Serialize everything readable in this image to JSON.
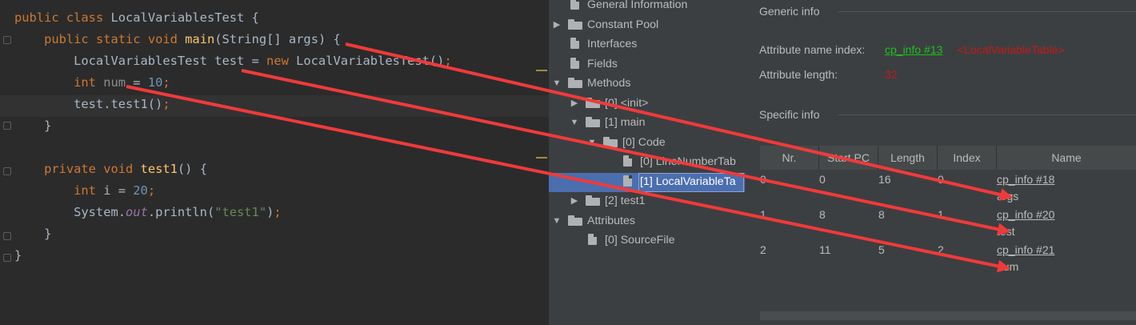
{
  "editor": {
    "lines": [
      [
        {
          "t": "public ",
          "c": "kw"
        },
        {
          "t": "class ",
          "c": "kw"
        },
        {
          "t": "LocalVariablesTest {",
          "c": ""
        }
      ],
      [
        {
          "t": "    public ",
          "c": "kw"
        },
        {
          "t": "static ",
          "c": "kw"
        },
        {
          "t": "void ",
          "c": "kw"
        },
        {
          "t": "main",
          "c": "fn"
        },
        {
          "t": "(String[] args) {",
          "c": ""
        }
      ],
      [
        {
          "t": "        LocalVariablesTest test = ",
          "c": ""
        },
        {
          "t": "new ",
          "c": "kw"
        },
        {
          "t": "LocalVariablesTest()",
          "c": ""
        },
        {
          "t": ";",
          "c": "kw"
        }
      ],
      [
        {
          "t": "        int ",
          "c": "kw"
        },
        {
          "t": "num",
          "c": "unused"
        },
        {
          "t": " = ",
          "c": ""
        },
        {
          "t": "10",
          "c": "num"
        },
        {
          "t": ";",
          "c": "kw"
        }
      ],
      [
        {
          "t": "        test.test1()",
          "c": ""
        },
        {
          "t": ";",
          "c": "kw"
        }
      ],
      [
        {
          "t": "    }",
          "c": ""
        }
      ],
      [],
      [
        {
          "t": "    private ",
          "c": "kw"
        },
        {
          "t": "void ",
          "c": "kw"
        },
        {
          "t": "test1",
          "c": "fn"
        },
        {
          "t": "() {",
          "c": ""
        }
      ],
      [
        {
          "t": "        int ",
          "c": "kw"
        },
        {
          "t": "i = ",
          "c": ""
        },
        {
          "t": "20",
          "c": "num"
        },
        {
          "t": ";",
          "c": "kw"
        }
      ],
      [
        {
          "t": "        System.",
          "c": ""
        },
        {
          "t": "out",
          "c": "fld"
        },
        {
          "t": ".println(",
          "c": ""
        },
        {
          "t": "\"test1\"",
          "c": "str"
        },
        {
          "t": ")",
          "c": ""
        },
        {
          "t": ";",
          "c": "kw"
        }
      ],
      [
        {
          "t": "    }",
          "c": ""
        }
      ],
      [
        {
          "t": "}",
          "c": ""
        }
      ]
    ]
  },
  "tree": {
    "nodes": [
      {
        "label": "General Information",
        "arrow": "",
        "icon": "file-icon",
        "level": 0
      },
      {
        "label": "Constant Pool",
        "arrow": "▶",
        "icon": "folder-icon",
        "level": 0
      },
      {
        "label": "Interfaces",
        "arrow": "",
        "icon": "file-icon",
        "level": 0
      },
      {
        "label": "Fields",
        "arrow": "",
        "icon": "file-icon",
        "level": 0
      },
      {
        "label": "Methods",
        "arrow": "▼",
        "icon": "folder-icon",
        "level": 0
      },
      {
        "label": "[0] <init>",
        "arrow": "▶",
        "icon": "folder-icon",
        "level": 1
      },
      {
        "label": "[1] main",
        "arrow": "▼",
        "icon": "folder-icon",
        "level": 1
      },
      {
        "label": "[0] Code",
        "arrow": "▼",
        "icon": "folder-icon",
        "level": 2
      },
      {
        "label": "[0] LineNumberTab",
        "arrow": "",
        "icon": "file-icon",
        "level": 3
      },
      {
        "label": "[1] LocalVariableTa",
        "arrow": "",
        "icon": "file-icon",
        "level": 3,
        "selected": true
      },
      {
        "label": "[2] test1",
        "arrow": "▶",
        "icon": "folder-icon",
        "level": 1
      },
      {
        "label": "Attributes",
        "arrow": "▼",
        "icon": "folder-icon",
        "level": 0
      },
      {
        "label": "[0] SourceFile",
        "arrow": "",
        "icon": "file-icon",
        "level": 1
      }
    ]
  },
  "detail": {
    "generic_title": "Generic info",
    "attr_name_label": "Attribute name index:",
    "attr_name_link": "cp_info #13",
    "attr_name_value": "<LocalVariableTable>",
    "attr_len_label": "Attribute length:",
    "attr_len_value": "32",
    "specific_title": "Specific info",
    "columns": [
      "Nr.",
      "Start PC",
      "Length",
      "Index",
      "Name"
    ],
    "rows": [
      {
        "nr": "0",
        "start": "0",
        "length": "16",
        "index": "0",
        "link": "cp_info #18",
        "name": "args"
      },
      {
        "nr": "1",
        "start": "8",
        "length": "8",
        "index": "1",
        "link": "cp_info #20",
        "name": "test"
      },
      {
        "nr": "2",
        "start": "11",
        "length": "5",
        "index": "2",
        "link": "cp_info #21",
        "name": "num"
      }
    ]
  },
  "colors": {
    "annotation_arrow": "#f03a3a",
    "link": "#19c319",
    "value_red": "#c41a1a",
    "selection": "#4b6eaf"
  }
}
